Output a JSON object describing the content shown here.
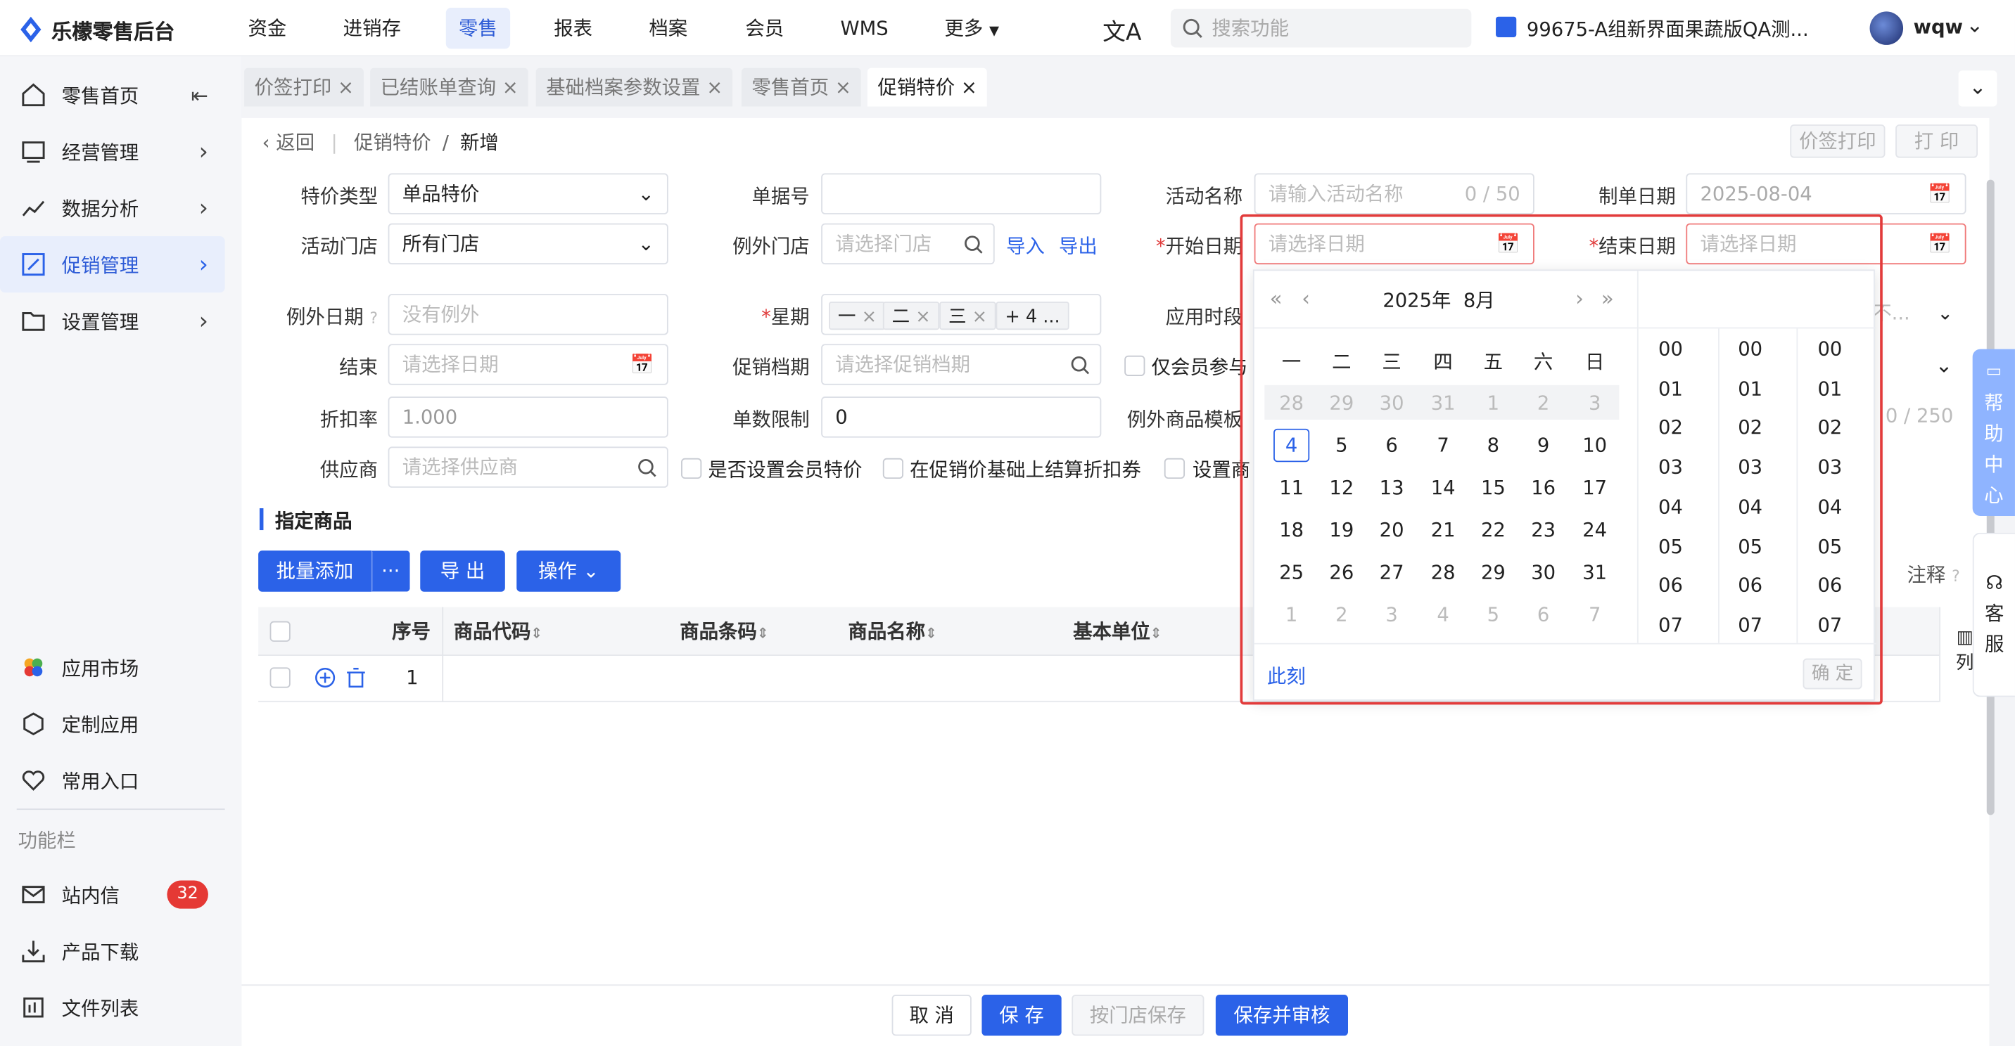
{
  "app": {
    "name": "乐檬零售后台"
  },
  "topnav": [
    "资金",
    "进销存",
    "零售",
    "报表",
    "档案",
    "会员",
    "WMS",
    "更多"
  ],
  "search_placeholder": "搜索功能",
  "store": "99675-A组新界面果蔬版QA测...",
  "user": "wqw",
  "sidebar": {
    "items": [
      "零售首页",
      "经营管理",
      "数据分析",
      "促销管理",
      "设置管理"
    ],
    "apps": [
      "应用市场",
      "定制应用",
      "常用入口"
    ],
    "section": "功能栏",
    "tools": [
      "站内信",
      "产品下载",
      "文件列表"
    ],
    "badge": "32"
  },
  "tabs": [
    "价签打印",
    "已结账单查询",
    "基础档案参数设置",
    "零售首页",
    "促销特价"
  ],
  "breadcrumb": {
    "back": "返回",
    "parent": "促销特价",
    "current": "新增"
  },
  "header_buttons": {
    "print_label": "价签打印",
    "print": "打 印"
  },
  "form": {
    "type_label": "特价类型",
    "type_value": "单品特价",
    "doc_label": "单据号",
    "activity_label": "活动名称",
    "activity_ph": "请输入活动名称",
    "activity_count": "0 / 50",
    "date_label": "制单日期",
    "date_value": "2025-08-04",
    "store_label": "活动门店",
    "store_value": "所有门店",
    "except_store_label": "例外门店",
    "except_store_ph": "请选择门店",
    "import": "导入",
    "export": "导出",
    "start_label": "开始日期",
    "start_ph": "请选择日期",
    "end_label": "结束日期",
    "end_ph": "请选择日期",
    "except_date_label": "例外日期",
    "except_date_value": "没有例外",
    "week_label": "星期",
    "week_tags": [
      "一",
      "二",
      "三"
    ],
    "week_more": "+ 4 ...",
    "period_label": "应用时段",
    "period_value": "不...",
    "end2_label": "结束",
    "end2_ph": "请选择日期",
    "archive_label": "促销档期",
    "archive_ph": "请选择促销档期",
    "member_only": "仅会员参与",
    "discount_label": "折扣率",
    "discount_value": "1.000",
    "limit_label": "单数限制",
    "limit_value": "0",
    "except_tpl_label": "例外商品模板",
    "tpl_count": "0 / 250",
    "supplier_label": "供应商",
    "supplier_ph": "请选择供应商",
    "cb_member_price": "是否设置会员特价",
    "cb_coupon": "在促销价基础上结算折扣券",
    "cb_set": "设置商"
  },
  "section_title": "指定商品",
  "toolbar": {
    "batch_add": "批量添加",
    "more": "···",
    "export": "导 出",
    "ops": "操作",
    "note": "注释"
  },
  "table": {
    "headers": [
      "序号",
      "商品代码",
      "商品条码",
      "商品名称",
      "基本单位"
    ],
    "rows": [
      {
        "seq": "1"
      }
    ],
    "col_toggle": "列"
  },
  "footer": {
    "cancel": "取 消",
    "save": "保 存",
    "store_save": "按门店保存",
    "save_audit": "保存并审核"
  },
  "picker": {
    "title": "2025年  8月",
    "weekdays": [
      "一",
      "二",
      "三",
      "四",
      "五",
      "六",
      "日"
    ],
    "prev_days": [
      "28",
      "29",
      "30",
      "31",
      "1",
      "2",
      "3"
    ],
    "weeks": [
      [
        "4",
        "5",
        "6",
        "7",
        "8",
        "9",
        "10"
      ],
      [
        "11",
        "12",
        "13",
        "14",
        "15",
        "16",
        "17"
      ],
      [
        "18",
        "19",
        "20",
        "21",
        "22",
        "23",
        "24"
      ],
      [
        "25",
        "26",
        "27",
        "28",
        "29",
        "30",
        "31"
      ]
    ],
    "next_days": [
      "1",
      "2",
      "3",
      "4",
      "5",
      "6",
      "7"
    ],
    "times": [
      "00",
      "01",
      "02",
      "03",
      "04",
      "05",
      "06",
      "07"
    ],
    "now": "此刻",
    "ok": "确 定"
  },
  "side_help": [
    "帮",
    "助",
    "中",
    "心"
  ],
  "side_service": [
    "客",
    "服"
  ],
  "colors": {
    "accent": "#2b62e8",
    "red": "#e23b3b",
    "active_bg": "#e8eefc"
  }
}
